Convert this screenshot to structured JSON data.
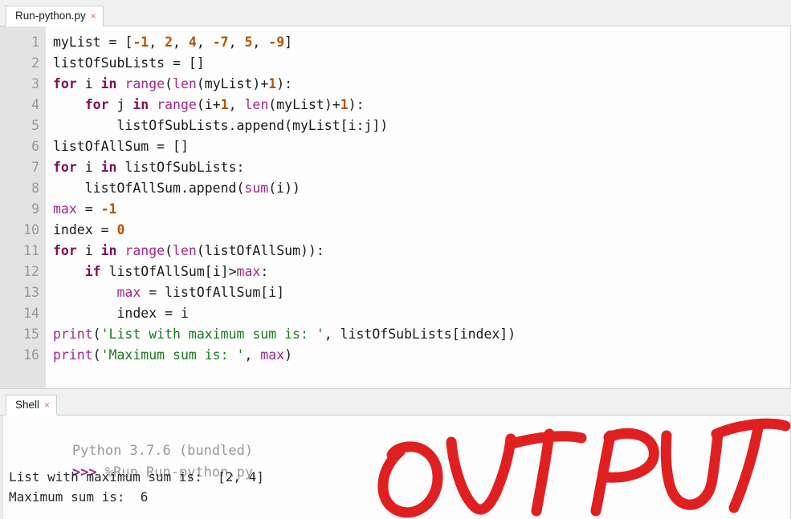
{
  "window": {
    "app": "Thonny",
    "title": "Run-python.py"
  },
  "editor_tab": {
    "label": "Run-python.py",
    "close_glyph": "×"
  },
  "shell_tab": {
    "label": "Shell",
    "close_glyph": "×"
  },
  "editor": {
    "line_numbers": [
      "1",
      "2",
      "3",
      "4",
      "5",
      "6",
      "7",
      "8",
      "9",
      "10",
      "11",
      "12",
      "13",
      "14",
      "15",
      "16"
    ],
    "lines": [
      {
        "n": 1,
        "tokens": [
          {
            "t": "myList = [",
            "c": "pl"
          },
          {
            "t": "-1",
            "c": "num"
          },
          {
            "t": ", ",
            "c": "pl"
          },
          {
            "t": "2",
            "c": "num"
          },
          {
            "t": ", ",
            "c": "pl"
          },
          {
            "t": "4",
            "c": "num"
          },
          {
            "t": ", ",
            "c": "pl"
          },
          {
            "t": "-7",
            "c": "num"
          },
          {
            "t": ", ",
            "c": "pl"
          },
          {
            "t": "5",
            "c": "num"
          },
          {
            "t": ", ",
            "c": "pl"
          },
          {
            "t": "-9",
            "c": "num"
          },
          {
            "t": "]",
            "c": "pl"
          }
        ]
      },
      {
        "n": 2,
        "tokens": [
          {
            "t": "listOfSubLists = []",
            "c": "pl"
          }
        ]
      },
      {
        "n": 3,
        "tokens": [
          {
            "t": "for",
            "c": "kw"
          },
          {
            "t": " i ",
            "c": "pl"
          },
          {
            "t": "in",
            "c": "kw"
          },
          {
            "t": " ",
            "c": "pl"
          },
          {
            "t": "range",
            "c": "bi"
          },
          {
            "t": "(",
            "c": "pl"
          },
          {
            "t": "len",
            "c": "bi"
          },
          {
            "t": "(myList)+",
            "c": "pl"
          },
          {
            "t": "1",
            "c": "num"
          },
          {
            "t": "):",
            "c": "pl"
          }
        ]
      },
      {
        "n": 4,
        "tokens": [
          {
            "t": "    ",
            "c": "pl"
          },
          {
            "t": "for",
            "c": "kw"
          },
          {
            "t": " j ",
            "c": "pl"
          },
          {
            "t": "in",
            "c": "kw"
          },
          {
            "t": " ",
            "c": "pl"
          },
          {
            "t": "range",
            "c": "bi"
          },
          {
            "t": "(i+",
            "c": "pl"
          },
          {
            "t": "1",
            "c": "num"
          },
          {
            "t": ", ",
            "c": "pl"
          },
          {
            "t": "len",
            "c": "bi"
          },
          {
            "t": "(myList)+",
            "c": "pl"
          },
          {
            "t": "1",
            "c": "num"
          },
          {
            "t": "):",
            "c": "pl"
          }
        ]
      },
      {
        "n": 5,
        "tokens": [
          {
            "t": "        listOfSubLists.append(myList[i:j])",
            "c": "pl"
          }
        ]
      },
      {
        "n": 6,
        "tokens": [
          {
            "t": "listOfAllSum = []",
            "c": "pl"
          }
        ]
      },
      {
        "n": 7,
        "tokens": [
          {
            "t": "for",
            "c": "kw"
          },
          {
            "t": " i ",
            "c": "pl"
          },
          {
            "t": "in",
            "c": "kw"
          },
          {
            "t": " listOfSubLists:",
            "c": "pl"
          }
        ]
      },
      {
        "n": 8,
        "tokens": [
          {
            "t": "    listOfAllSum.append(",
            "c": "pl"
          },
          {
            "t": "sum",
            "c": "bi"
          },
          {
            "t": "(i))",
            "c": "pl"
          }
        ]
      },
      {
        "n": 9,
        "tokens": [
          {
            "t": "max",
            "c": "bi"
          },
          {
            "t": " = ",
            "c": "pl"
          },
          {
            "t": "-1",
            "c": "num"
          }
        ]
      },
      {
        "n": 10,
        "tokens": [
          {
            "t": "index = ",
            "c": "pl"
          },
          {
            "t": "0",
            "c": "num"
          }
        ]
      },
      {
        "n": 11,
        "tokens": [
          {
            "t": "for",
            "c": "kw"
          },
          {
            "t": " i ",
            "c": "pl"
          },
          {
            "t": "in",
            "c": "kw"
          },
          {
            "t": " ",
            "c": "pl"
          },
          {
            "t": "range",
            "c": "bi"
          },
          {
            "t": "(",
            "c": "pl"
          },
          {
            "t": "len",
            "c": "bi"
          },
          {
            "t": "(listOfAllSum)):",
            "c": "pl"
          }
        ]
      },
      {
        "n": 12,
        "tokens": [
          {
            "t": "    ",
            "c": "pl"
          },
          {
            "t": "if",
            "c": "kw"
          },
          {
            "t": " listOfAllSum[i]>",
            "c": "pl"
          },
          {
            "t": "max",
            "c": "bi"
          },
          {
            "t": ":",
            "c": "pl"
          }
        ]
      },
      {
        "n": 13,
        "tokens": [
          {
            "t": "        ",
            "c": "pl"
          },
          {
            "t": "max",
            "c": "bi"
          },
          {
            "t": " = listOfAllSum[i]",
            "c": "pl"
          }
        ]
      },
      {
        "n": 14,
        "tokens": [
          {
            "t": "        index = i",
            "c": "pl"
          }
        ]
      },
      {
        "n": 15,
        "tokens": [
          {
            "t": "print",
            "c": "bi"
          },
          {
            "t": "(",
            "c": "pl"
          },
          {
            "t": "'List with maximum sum is: '",
            "c": "str"
          },
          {
            "t": ", listOfSubLists[index])",
            "c": "pl"
          }
        ]
      },
      {
        "n": 16,
        "tokens": [
          {
            "t": "print",
            "c": "bi"
          },
          {
            "t": "(",
            "c": "pl"
          },
          {
            "t": "'Maximum sum is: '",
            "c": "str"
          },
          {
            "t": ", ",
            "c": "pl"
          },
          {
            "t": "max",
            "c": "bi"
          },
          {
            "t": ")",
            "c": "pl"
          }
        ]
      }
    ]
  },
  "shell": {
    "banner": "Python 3.7.6 (bundled)",
    "prompt": ">>>",
    "command": "%Run Run-python.py",
    "output_lines": [
      "List with maximum sum is:  [2, 4]",
      "Maximum sum is:  6"
    ]
  },
  "annotation": {
    "text": "OUTPUT",
    "color": "#e02020"
  },
  "colors": {
    "keyword": "#7f0f55",
    "builtin": "#a0298c",
    "number": "#b35400",
    "string": "#197a1e",
    "plain": "#1a1a1a",
    "gutter_bg": "#e3e3e3",
    "editor_bg": "#fdfdfd",
    "chrome_bg": "#f0f0f0",
    "annotation_red": "#e02020"
  }
}
